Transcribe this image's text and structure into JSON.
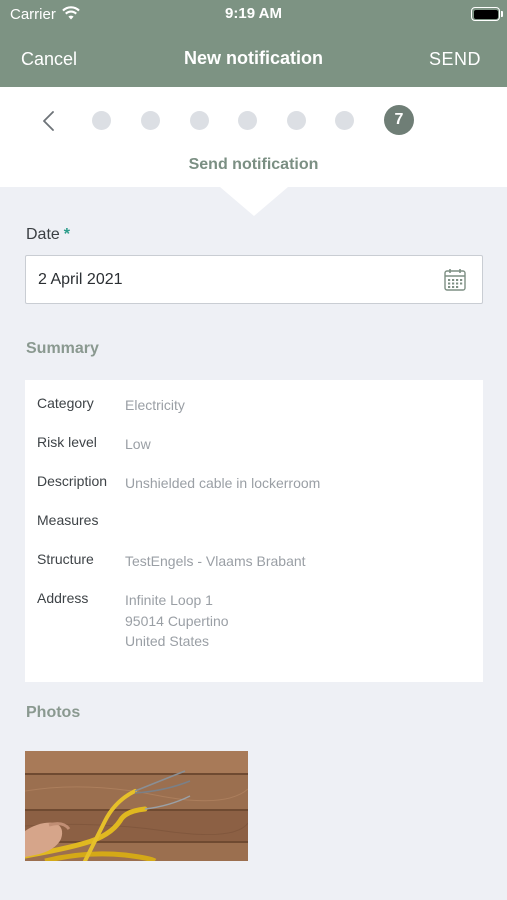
{
  "status_bar": {
    "carrier": "Carrier",
    "time": "9:19 AM"
  },
  "nav": {
    "cancel": "Cancel",
    "title": "New notification",
    "send": "SEND"
  },
  "stepper": {
    "total_steps": 7,
    "current_step": "7",
    "step_title": "Send notification"
  },
  "date_field": {
    "label": "Date",
    "required_marker": "*",
    "value": "2 April 2021"
  },
  "summary": {
    "heading": "Summary",
    "rows": [
      {
        "key": "Category",
        "value": "Electricity"
      },
      {
        "key": "Risk level",
        "value": "Low"
      },
      {
        "key": "Description",
        "value": "Unshielded cable in lockerroom"
      },
      {
        "key": "Measures",
        "value": ""
      },
      {
        "key": "Structure",
        "value": "TestEngels - Vlaams Brabant"
      },
      {
        "key": "Address",
        "value_lines": [
          "Infinite Loop 1",
          "95014 Cupertino",
          "United States"
        ]
      }
    ]
  },
  "photos": {
    "heading": "Photos"
  },
  "icons": [
    "wifi-icon",
    "battery-icon",
    "chevron-left-icon",
    "calendar-icon"
  ],
  "colors": {
    "header": "#7d9383",
    "accent": "#2c9c8a",
    "active_step": "#6f7e76"
  }
}
